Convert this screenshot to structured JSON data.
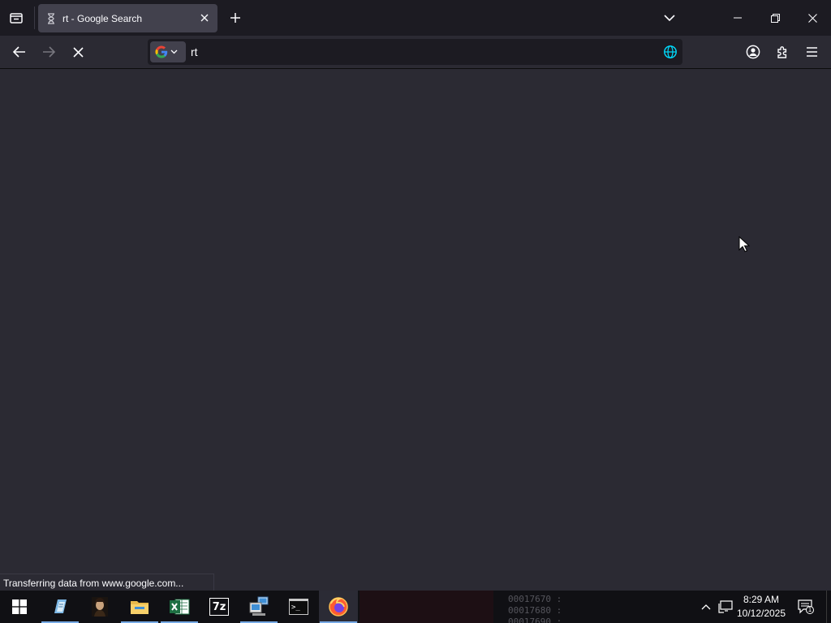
{
  "browser": {
    "tab": {
      "title": "rt - Google Search",
      "loading": true
    },
    "urlbar": {
      "value": "rt",
      "search_engine_icon": "google-g-icon"
    },
    "status_text": "Transferring data from www.google.com..."
  },
  "taskbar": {
    "apps": [
      {
        "name": "start",
        "icon": "windows-logo-icon"
      },
      {
        "name": "notepad-app",
        "icon": "notepad-icon"
      },
      {
        "name": "portrait-app",
        "icon": "portrait-icon"
      },
      {
        "name": "file-explorer",
        "icon": "folder-icon"
      },
      {
        "name": "excel-app",
        "icon": "excel-icon"
      },
      {
        "name": "7zip-app",
        "icon": "7zip-icon"
      },
      {
        "name": "network-app",
        "icon": "network-computer-icon"
      },
      {
        "name": "terminal-app",
        "icon": "terminal-icon"
      },
      {
        "name": "firefox-app",
        "icon": "firefox-icon"
      }
    ],
    "seven_zip_label": "7z",
    "terminal_prompt": ">_",
    "hex_lines": [
      "00017670  :",
      "00017680  :",
      "00017690  :"
    ],
    "clock": {
      "time": "8:29 AM",
      "date": "10/12/2025"
    },
    "notification_count": "1"
  },
  "colors": {
    "tab_bg": "#42414d",
    "toolbar_bg": "#2b2a33",
    "tabstrip_bg": "#1c1b22",
    "globe_accent": "#00ddff",
    "taskbar_bg": "#101014"
  }
}
